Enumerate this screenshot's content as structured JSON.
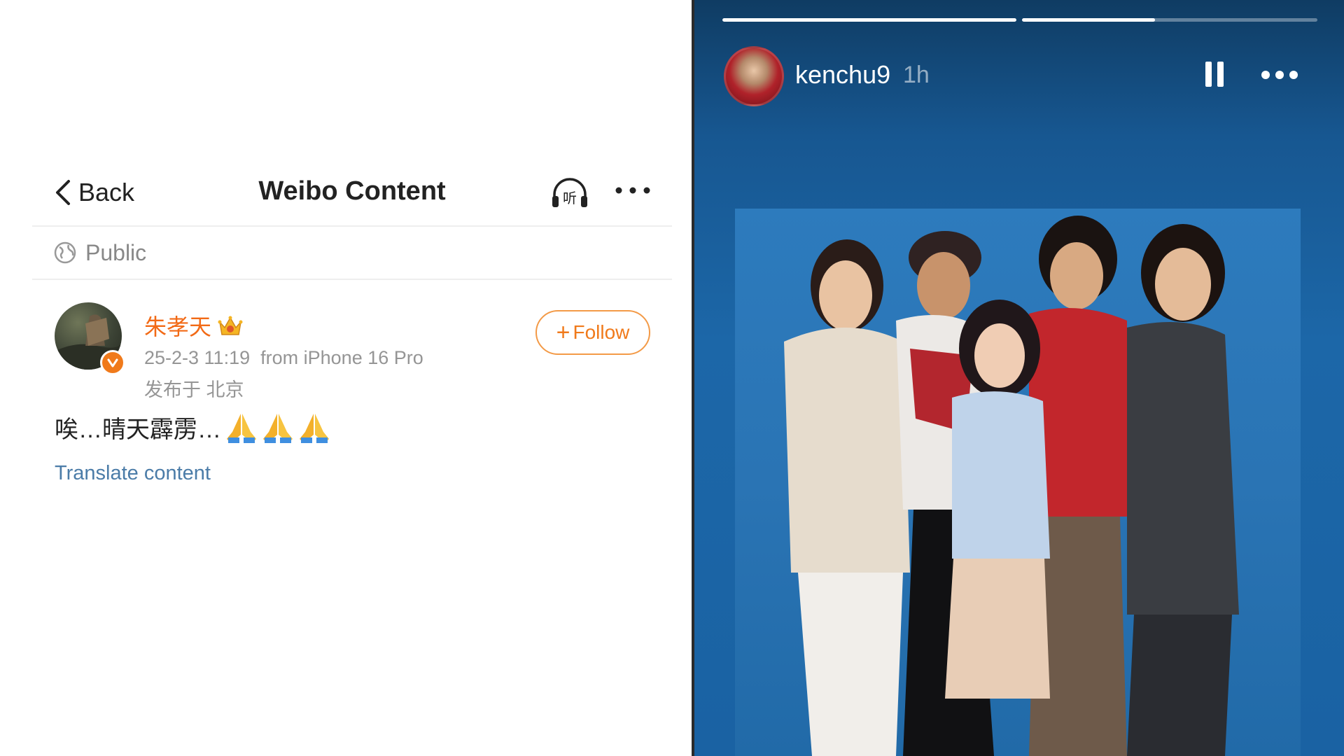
{
  "weibo": {
    "header": {
      "back_label": "Back",
      "title": "Weibo Content",
      "listen_icon_text": "听"
    },
    "visibility": {
      "label": "Public"
    },
    "post": {
      "author": "朱孝天",
      "datetime": "25-2-3 11:19",
      "source": "from iPhone 16 Pro",
      "location": "发布于 北京",
      "text": "唉…晴天霹雳…",
      "translate_label": "Translate content",
      "follow_label": "Follow"
    },
    "colors": {
      "accent": "#f07a1b",
      "link": "#4b7ca8"
    }
  },
  "story": {
    "username": "kenchu9",
    "time": "1h",
    "progress": [
      1.0,
      0.45
    ],
    "background": "#1c67a8"
  },
  "icons": [
    "back-chevron-icon",
    "headphones-icon",
    "more-icon",
    "globe-icon",
    "verified-icon",
    "crown-icon",
    "praying-hands-icon",
    "pause-icon"
  ]
}
